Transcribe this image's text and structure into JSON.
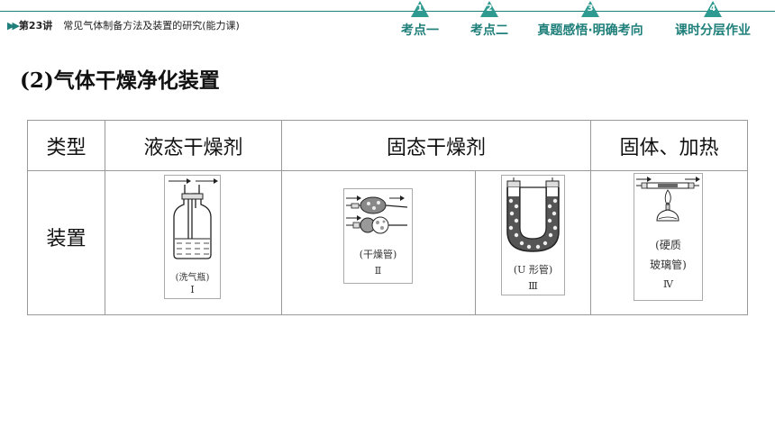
{
  "header": {
    "lesson_number": "第23讲",
    "lesson_title": "常见气体制备方法及装置的研究(能力课)",
    "nav": [
      {
        "num": "1",
        "label": "考点一"
      },
      {
        "num": "2",
        "label": "考点二"
      },
      {
        "num": "3",
        "label": "真题感悟·明确考向"
      },
      {
        "num": "4",
        "label": "课时分层作业"
      }
    ],
    "accent_color": "#1f7f7a"
  },
  "section_heading": "(2)气体干燥净化装置",
  "table": {
    "col_type": "类型",
    "col_liquid": "液态干燥剂",
    "col_solid": "固态干燥剂",
    "col_heat": "固体、加热",
    "row_label": "装置",
    "apparatus": [
      {
        "caption": "(洗气瓶)",
        "roman": "I"
      },
      {
        "caption": "(干燥管)",
        "roman": "Ⅱ"
      },
      {
        "caption": "(U 形管)",
        "roman": "Ⅲ"
      },
      {
        "caption_line1": "(硬质",
        "caption_line2": "玻璃管)",
        "roman": "Ⅳ"
      }
    ]
  }
}
